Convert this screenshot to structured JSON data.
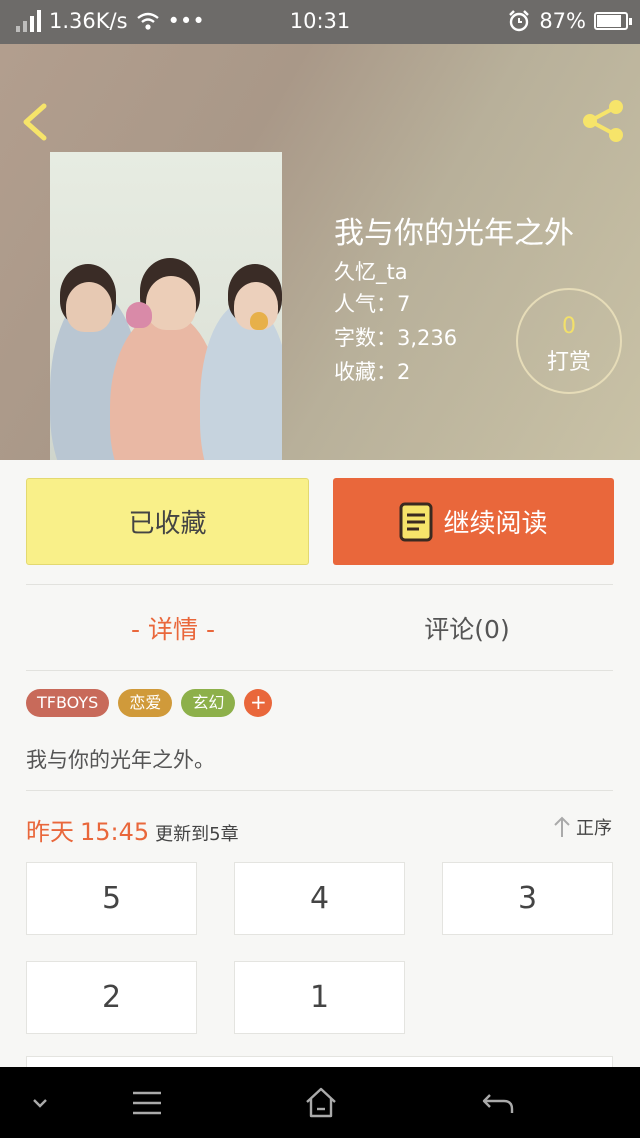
{
  "status_bar": {
    "speed": "1.36K/s",
    "dots": "•••",
    "time": "10:31",
    "battery": "87%",
    "battery_level": 0.87
  },
  "header": {
    "back_icon": "chevron-left-icon",
    "share_icon": "share-icon"
  },
  "book": {
    "title": "我与你的光年之外",
    "author": "久忆_ta",
    "popularity": "人气：7",
    "word_count": "字数：3,236",
    "favorites": "收藏：2",
    "tip_count": "0",
    "tip_label": "打赏",
    "summary": "我与你的光年之外。"
  },
  "actions": {
    "favorited": "已收藏",
    "continue_reading": "继续阅读"
  },
  "tabs": {
    "details": "- 详情 -",
    "comments": "评论(0)"
  },
  "tags": [
    {
      "label": "TFBOYS",
      "color": "#c86a5a"
    },
    {
      "label": "恋爱",
      "color": "#d09a3a"
    },
    {
      "label": "玄幻",
      "color": "#8db04a"
    }
  ],
  "tag_add": {
    "label": "+",
    "color": "#e9673b"
  },
  "update": {
    "day": "昨天",
    "time": "15:45",
    "text": "更新到5章",
    "sort_label": "正序"
  },
  "chapters": [
    "5",
    "4",
    "3",
    "2",
    "1"
  ],
  "colors": {
    "accent": "#e9673b",
    "favorite_bg": "#f9f089",
    "tip_number": "#f2e06a"
  }
}
